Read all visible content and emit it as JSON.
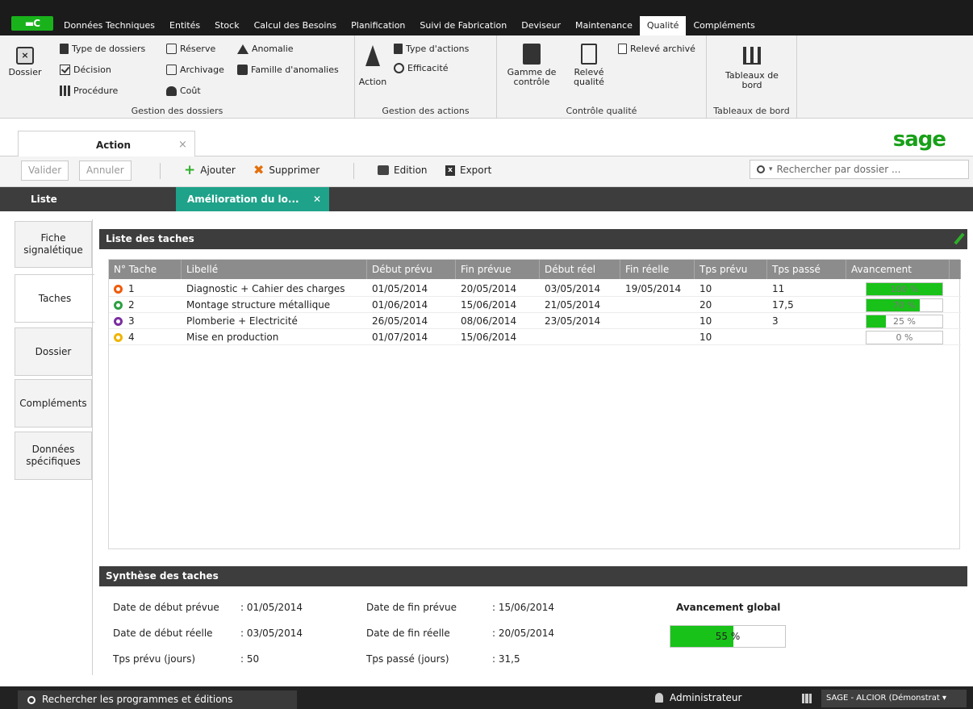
{
  "menu": {
    "logo": "▬C",
    "tabs": [
      "Données Techniques",
      "Entités",
      "Stock",
      "Calcul des Besoins",
      "Planification",
      "Suivi de Fabrication",
      "Deviseur",
      "Maintenance",
      "Qualité",
      "Compléments"
    ],
    "active_tab": "Qualité"
  },
  "ribbon": {
    "gestion_dossiers": {
      "label": "Gestion des dossiers",
      "dossier": "Dossier",
      "type_dossiers": "Type de dossiers",
      "decision": "Décision",
      "procedure": "Procédure",
      "reserve": "Réserve",
      "archivage": "Archivage",
      "cout": "Coût",
      "anomalie": "Anomalie",
      "famille_anomalies": "Famille d'anomalies"
    },
    "gestion_actions": {
      "label": "Gestion des actions",
      "action": "Action",
      "type_actions": "Type d'actions",
      "efficacite": "Efficacité"
    },
    "controle_qualite": {
      "label": "Contrôle qualité",
      "gamme_l1": "Gamme de",
      "gamme_l2": "contrôle",
      "releve_l1": "Relevé",
      "releve_l2": "qualité",
      "releve_archive": "Relevé archivé"
    },
    "tableaux_bord": {
      "label": "Tableaux de bord",
      "btn_l1": "Tableaux de",
      "btn_l2": "bord"
    }
  },
  "doc_tab": {
    "title": "Action",
    "close": "×"
  },
  "brand": "sage",
  "toolbar": {
    "valider": "Valider",
    "annuler": "Annuler",
    "ajouter": "Ajouter",
    "supprimer": "Supprimer",
    "edition": "Edition",
    "export": "Export",
    "search_placeholder": "Rechercher par dossier ..."
  },
  "subtabs": {
    "liste": "Liste",
    "current": "Amélioration du lo...",
    "close": "✕"
  },
  "side_tabs": [
    {
      "l1": "Fiche",
      "l2": "signalétique"
    },
    {
      "l1": "Taches",
      "l2": ""
    },
    {
      "l1": "Dossier",
      "l2": ""
    },
    {
      "l1": "Compléments",
      "l2": ""
    },
    {
      "l1": "Données",
      "l2": "spécifiques"
    }
  ],
  "tasks_panel": {
    "title": "Liste des taches",
    "columns": [
      "N° Tache",
      "Libellé",
      "Début prévu",
      "Fin prévue",
      "Début réel",
      "Fin réelle",
      "Tps prévu",
      "Tps passé",
      "Avancement"
    ],
    "rows": [
      {
        "num": "1",
        "color": "#f15a0a",
        "label": "Diagnostic + Cahier des charges",
        "debut_prevu": "01/05/2014",
        "fin_prevue": "20/05/2014",
        "debut_reel": "03/05/2014",
        "fin_reelle": "19/05/2014",
        "tps_prevu": "10",
        "tps_passe": "11",
        "progress": 100,
        "progress_text": "100 %"
      },
      {
        "num": "2",
        "color": "#2ea043",
        "label": "Montage structure métallique",
        "debut_prevu": "01/06/2014",
        "fin_prevue": "15/06/2014",
        "debut_reel": "21/05/2014",
        "fin_reelle": "",
        "tps_prevu": "20",
        "tps_passe": "17,5",
        "progress": 70,
        "progress_text": "70 %"
      },
      {
        "num": "3",
        "color": "#7a2fa0",
        "label": "Plomberie + Electricité",
        "debut_prevu": "26/05/2014",
        "fin_prevue": "08/06/2014",
        "debut_reel": "23/05/2014",
        "fin_reelle": "",
        "tps_prevu": "10",
        "tps_passe": "3",
        "progress": 25,
        "progress_text": "25 %"
      },
      {
        "num": "4",
        "color": "#f0b400",
        "label": "Mise en production",
        "debut_prevu": "01/07/2014",
        "fin_prevue": "15/06/2014",
        "debut_reel": "",
        "fin_reelle": "",
        "tps_prevu": "10",
        "tps_passe": "",
        "progress": 0,
        "progress_text": "0 %"
      }
    ]
  },
  "synthese": {
    "title": "Synthèse des taches",
    "debut_prevue_label": "Date de début prévue",
    "debut_prevue_value": ": 01/05/2014",
    "debut_reelle_label": "Date de début réelle",
    "debut_reelle_value": ": 03/05/2014",
    "tps_prevu_label": "Tps prévu (jours)",
    "tps_prevu_value": ": 50",
    "fin_prevue_label": "Date de fin prévue",
    "fin_prevue_value": ": 15/06/2014",
    "fin_reelle_label": "Date de fin réelle",
    "fin_reelle_value": ": 20/05/2014",
    "tps_passe_label": "Tps passé (jours)",
    "tps_passe_value": ": 31,5",
    "global_label": "Avancement global",
    "global_progress": 55,
    "global_text": "55 %"
  },
  "statusbar": {
    "search": "Rechercher les programmes et éditions",
    "user": "Administrateur",
    "company": "SAGE - ALCIOR (Démonstrat ▾"
  }
}
